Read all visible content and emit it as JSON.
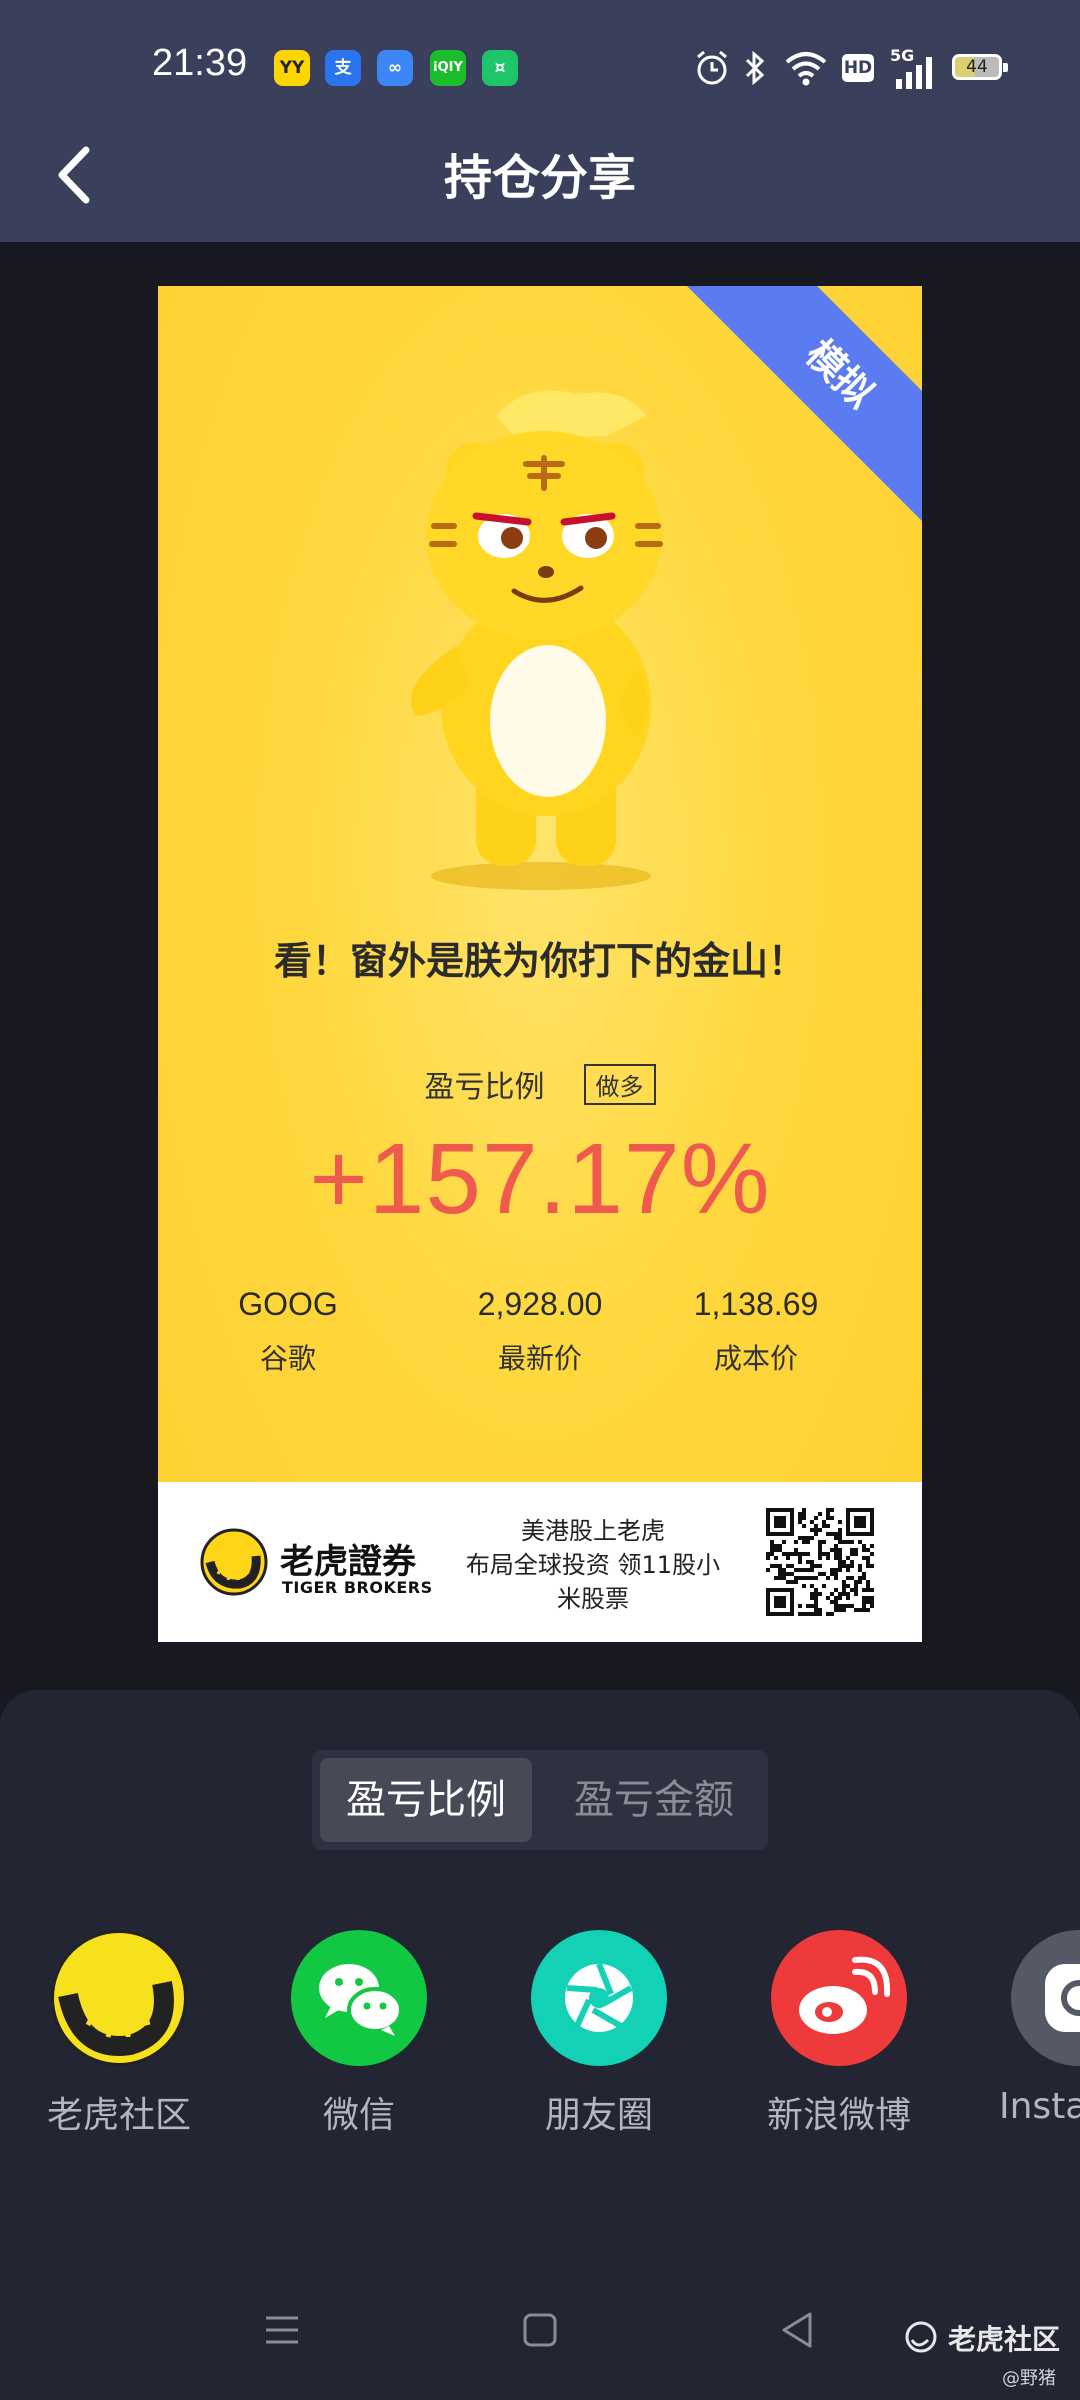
{
  "status_bar": {
    "time": "21:39",
    "apps": [
      "yy-app-icon",
      "alipay-app-icon",
      "infinity-app-icon",
      "iqiyi-app-icon",
      "green-app-icon"
    ],
    "network": "5G",
    "hd": "HD",
    "battery": "44"
  },
  "header": {
    "title": "持仓分享",
    "back_icon": "chevron-left-icon"
  },
  "card": {
    "sim_tag": "模拟",
    "slogan": "看！窗外是朕为你打下的金山！",
    "pnl_label": "盈亏比例",
    "direction": "做多",
    "pnl_value": "+157.17%",
    "pnl_color": "#ee5a4e",
    "stats": [
      {
        "value": "GOOG",
        "label": "谷歌"
      },
      {
        "value": "2,928.00",
        "label": "最新价"
      },
      {
        "value": "1,138.69",
        "label": "成本价"
      }
    ],
    "footer": {
      "brand_cn": "老虎證券",
      "brand_en": "TIGER BROKERS",
      "promo": "美港股上老虎\n布局全球投资 领11股小米股票"
    }
  },
  "sheet": {
    "toggle": {
      "options": [
        "盈亏比例",
        "盈亏金额"
      ],
      "selected": "盈亏比例"
    },
    "share_targets": [
      {
        "label": "老虎社区",
        "icon": "tiger-community-icon",
        "color": "#f7e11c"
      },
      {
        "label": "微信",
        "icon": "wechat-icon",
        "color": "#12c843"
      },
      {
        "label": "朋友圈",
        "icon": "moments-icon",
        "color": "#12d1b5"
      },
      {
        "label": "新浪微博",
        "icon": "weibo-icon",
        "color": "#ee3a3a"
      },
      {
        "label": "Instagram",
        "icon": "instagram-icon",
        "color": "#555865"
      }
    ]
  },
  "watermark": {
    "brand": "老虎社区",
    "user": "@野猪"
  }
}
